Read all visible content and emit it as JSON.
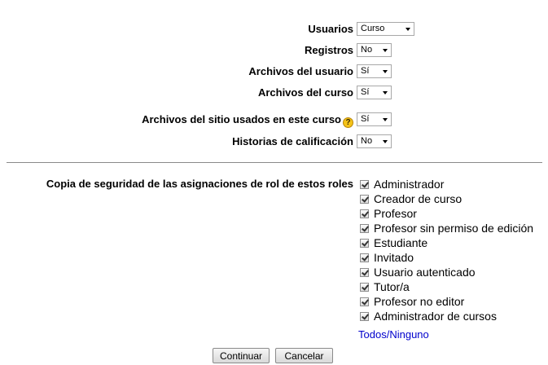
{
  "settings": [
    {
      "label": "Usuarios",
      "value": "Curso",
      "help": false
    },
    {
      "label": "Registros",
      "value": "No",
      "help": false
    },
    {
      "label": "Archivos del usuario",
      "value": "Sí",
      "help": false
    },
    {
      "label": "Archivos del curso",
      "value": "Sí",
      "help": false
    },
    {
      "label": "Archivos del sitio usados en este curso",
      "value": "Sí",
      "help": true
    },
    {
      "label": "Historias de calificación",
      "value": "No",
      "help": false
    }
  ],
  "roles": {
    "label": "Copia de seguridad de las asignaciones de rol de estos roles",
    "items": [
      {
        "label": "Administrador",
        "checked": true
      },
      {
        "label": "Creador de curso",
        "checked": true
      },
      {
        "label": "Profesor",
        "checked": true
      },
      {
        "label": "Profesor sin permiso de edición",
        "checked": true
      },
      {
        "label": "Estudiante",
        "checked": true
      },
      {
        "label": "Invitado",
        "checked": true
      },
      {
        "label": "Usuario autenticado",
        "checked": true
      },
      {
        "label": "Tutor/a",
        "checked": true
      },
      {
        "label": "Profesor no editor",
        "checked": true
      },
      {
        "label": "Administrador de cursos",
        "checked": true
      }
    ],
    "select_all": "Todos",
    "separator": "/",
    "select_none": "Ninguno"
  },
  "buttons": {
    "continue": "Continuar",
    "cancel": "Cancelar"
  },
  "colors": {
    "link": "#0000cc",
    "help_icon": "#f5c318"
  }
}
